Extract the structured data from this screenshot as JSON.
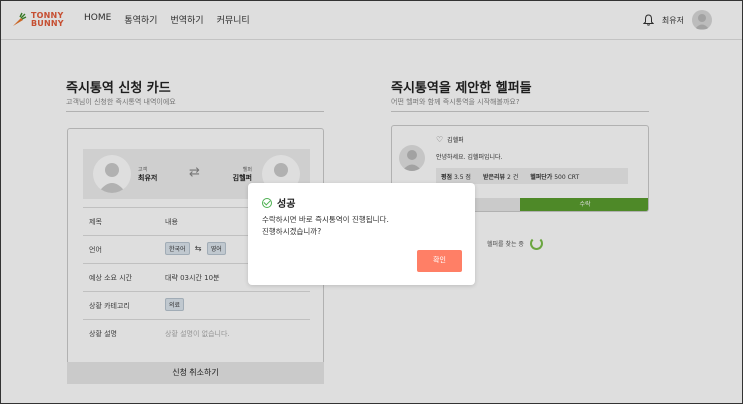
{
  "brand": {
    "line1": "TONNY",
    "line2": "BUNNY",
    "color": "#e45b3a"
  },
  "nav": {
    "home": "HOME",
    "interpret": "통역하기",
    "translate": "번역하기",
    "community": "커뮤니티"
  },
  "header": {
    "user_name": "최유저",
    "bell_icon": "bell-icon"
  },
  "left": {
    "title": "즉시통역 신청 카드",
    "subtitle": "고객님이 신청한 즉시통역 내역이에요",
    "customer_label": "고객",
    "customer_name": "최유저",
    "helper_label": "헬퍼",
    "helper_name": "김헬퍼",
    "rows": [
      {
        "key": "제목",
        "value": "내용"
      },
      {
        "key": "언어",
        "lang_from": "한국어",
        "lang_to": "영어"
      },
      {
        "key": "예상 소요 시간",
        "value": "대략 03시간 10분"
      },
      {
        "key": "상황 카테고리",
        "chip": "의료"
      },
      {
        "key": "상황 설명",
        "value": "상황 설명이 없습니다."
      }
    ],
    "cancel_label": "신청 취소하기"
  },
  "right": {
    "title": "즉시통역을 제안한 헬퍼들",
    "subtitle": "어떤 헬퍼와 함께 즉시통역을 시작해볼까요?",
    "helper": {
      "name": "김헬퍼",
      "message": "안녕하세요. 김헬퍼입니다.",
      "rating_label": "평점",
      "rating_value": "3.5 점",
      "reviews_label": "받은리뷰",
      "reviews_value": "2 건",
      "price_label": "헬퍼단가",
      "price_value": "500 CRT"
    },
    "accept_label": "수락",
    "searching_text": "헬퍼를 찾는 중"
  },
  "modal": {
    "title": "성공",
    "line1": "수락하시면 바로 즉시통역이 진행됩니다.",
    "line2": "진행하시겠습니까?",
    "confirm_label": "확인",
    "accent": "#ff7f66"
  }
}
